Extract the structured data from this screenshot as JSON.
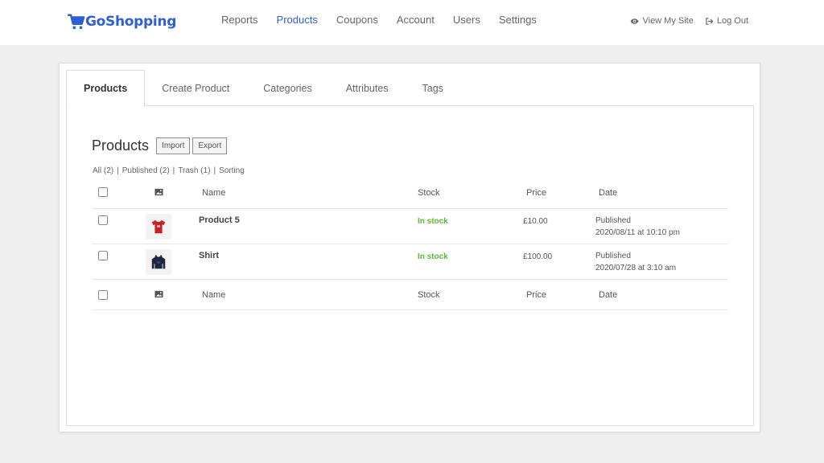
{
  "brand": {
    "name": "GoShopping",
    "color": "#2f5fd6"
  },
  "nav": [
    {
      "label": "Reports",
      "active": false
    },
    {
      "label": "Products",
      "active": true
    },
    {
      "label": "Coupons",
      "active": false
    },
    {
      "label": "Account",
      "active": false
    },
    {
      "label": "Users",
      "active": false
    },
    {
      "label": "Settings",
      "active": false
    }
  ],
  "top_links": {
    "view_site": "View My Site",
    "logout": "Log Out"
  },
  "tabs": [
    "Products",
    "Create Product",
    "Categories",
    "Attributes",
    "Tags"
  ],
  "page": {
    "title": "Products",
    "import_label": "Import",
    "export_label": "Export"
  },
  "filters": [
    "All (2)",
    "Published (2)",
    "Trash (1)",
    "Sorting"
  ],
  "columns": {
    "name": "Name",
    "stock": "Stock",
    "price": "Price",
    "date": "Date"
  },
  "products": [
    {
      "name": "Product 5",
      "stock": "In stock",
      "price": "£10.00",
      "status": "Published",
      "date": "2020/08/11 at 10:10 pm",
      "thumb": "red-tshirt-icon"
    },
    {
      "name": "Shirt",
      "stock": "In stock",
      "price": "£100.00",
      "status": "Published",
      "date": "2020/07/28 at 3:10 am",
      "thumb": "navy-hoodie-icon"
    }
  ],
  "colors": {
    "accent": "#2f5fd6",
    "in_stock": "#5fb832"
  }
}
